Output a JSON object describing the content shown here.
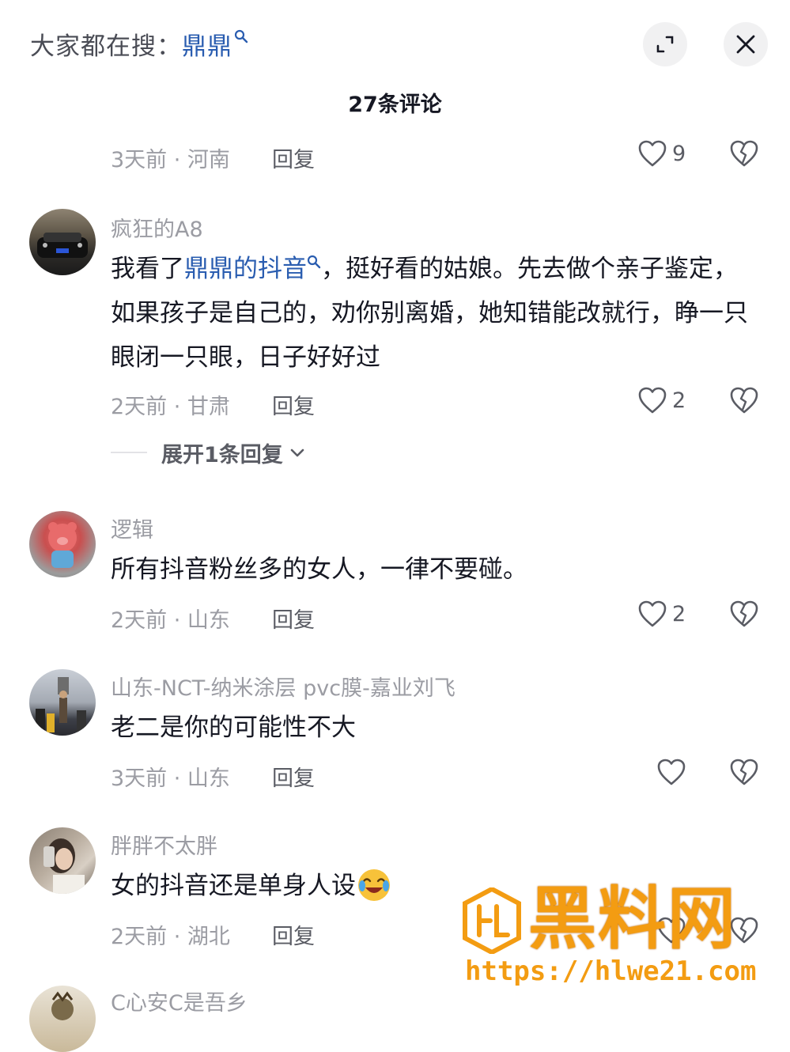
{
  "header": {
    "search_prefix": "大家都在搜：",
    "search_keyword": "鼎鼎",
    "expand_icon": "expand-icon",
    "close_icon": "close-icon"
  },
  "title": "27条评论",
  "top_meta": {
    "time_location": "3天前 · 河南",
    "reply": "回复",
    "likes": "9"
  },
  "comments": [
    {
      "username": "疯狂的A8",
      "content_before": "我看了",
      "content_keyword": "鼎鼎的抖音",
      "content_after": "，挺好看的姑娘。先去做个亲子鉴定，如果孩子是自己的，劝你别离婚，她知错能改就行，睁一只眼闭一只眼，日子好好过",
      "time_location": "2天前 · 甘肃",
      "reply": "回复",
      "likes": "2",
      "expand_replies": "展开1条回复"
    },
    {
      "username": "逻辑",
      "content": "所有抖音粉丝多的女人，一律不要碰。",
      "time_location": "2天前 · 山东",
      "reply": "回复",
      "likes": "2"
    },
    {
      "username": "山东-NCT-纳米涂层 pvc膜-嘉业刘飞",
      "content": "老二是你的可能性不大",
      "time_location": "3天前 · 山东",
      "reply": "回复",
      "likes": ""
    },
    {
      "username": "胖胖不太胖",
      "content": "女的抖音还是单身人设",
      "time_location": "2天前 · 湖北",
      "reply": "回复",
      "likes": ""
    },
    {
      "username": "C心安C是吾乡"
    }
  ],
  "watermark": {
    "name": "黑料网",
    "url": "https://hlwe21.com"
  },
  "colors": {
    "keyword": "#2a5db0",
    "watermark": "#f39c12",
    "secondary_text": "#9b9ca3"
  }
}
